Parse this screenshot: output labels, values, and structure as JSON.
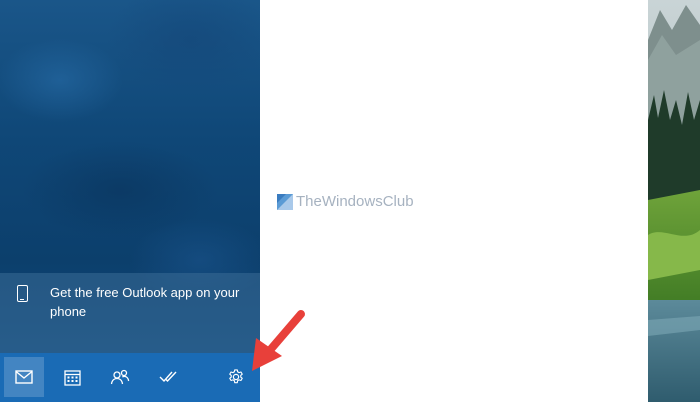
{
  "promo": {
    "text": "Get the free Outlook app on your phone",
    "icon": "phone-icon"
  },
  "navbar": {
    "items": [
      {
        "name": "mail",
        "icon": "mail-icon",
        "active": true
      },
      {
        "name": "calendar",
        "icon": "calendar-icon",
        "active": false
      },
      {
        "name": "people",
        "icon": "people-icon",
        "active": false
      },
      {
        "name": "todo",
        "icon": "todo-check-icon",
        "active": false
      },
      {
        "name": "settings",
        "icon": "settings-gear-icon",
        "active": false
      }
    ]
  },
  "watermark": {
    "text": "TheWindowsClub"
  },
  "colors": {
    "sidebar": "#0f4777",
    "navbar": "#1a6bb5",
    "annotation_arrow": "#e8403a",
    "watermark_text": "#a6b2c0"
  }
}
